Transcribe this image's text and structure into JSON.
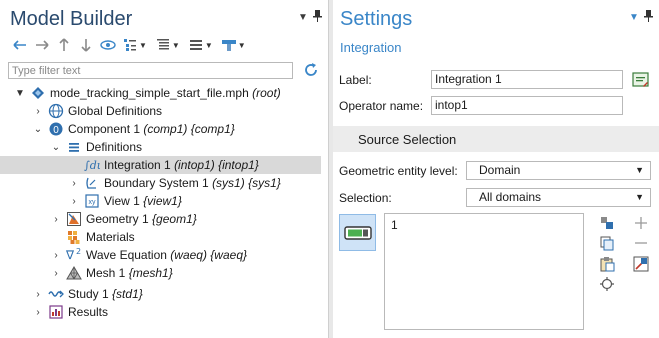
{
  "model_builder": {
    "title": "Model Builder",
    "filter_placeholder": "Type filter text",
    "toolbar": [
      "arrow-left-icon",
      "arrow-right-icon",
      "arrow-up-icon",
      "arrow-down-icon",
      "show-icon",
      "collapse-icon",
      "expand-icon",
      "build-icon"
    ],
    "tree": [
      {
        "label": "mode_tracking_simple_start_file.mph",
        "tag": "(root)"
      },
      {
        "label": "Global Definitions",
        "tag": ""
      },
      {
        "label": "Component 1",
        "tag": "(comp1) {comp1}"
      },
      {
        "label": "Definitions",
        "tag": ""
      },
      {
        "label": "Integration 1",
        "tag": "(intop1) {intop1}"
      },
      {
        "label": "Boundary System 1",
        "tag": "(sys1) {sys1}"
      },
      {
        "label": "View 1",
        "tag": "{view1}"
      },
      {
        "label": "Geometry 1",
        "tag": "{geom1}"
      },
      {
        "label": "Materials",
        "tag": ""
      },
      {
        "label": "Wave Equation",
        "tag": "(waeq) {waeq}"
      },
      {
        "label": "Mesh 1",
        "tag": "{mesh1}"
      },
      {
        "label": "Study 1",
        "tag": "{std1}"
      },
      {
        "label": "Results",
        "tag": ""
      }
    ]
  },
  "settings": {
    "title": "Settings",
    "subtitle": "Integration",
    "label_field": {
      "label": "Label:",
      "value": "Integration 1"
    },
    "operator_field": {
      "label": "Operator name:",
      "value": "intop1"
    },
    "section": "Source Selection",
    "entity_level": {
      "label": "Geometric entity level:",
      "value": "Domain"
    },
    "selection": {
      "label": "Selection:",
      "value": "All domains"
    },
    "selection_items": [
      "1"
    ]
  },
  "colors": {
    "accent": "#3a86c8",
    "title_dark": "#2a4a6e",
    "selected_row": "#d9d9d9",
    "section_bg": "#ececec"
  }
}
